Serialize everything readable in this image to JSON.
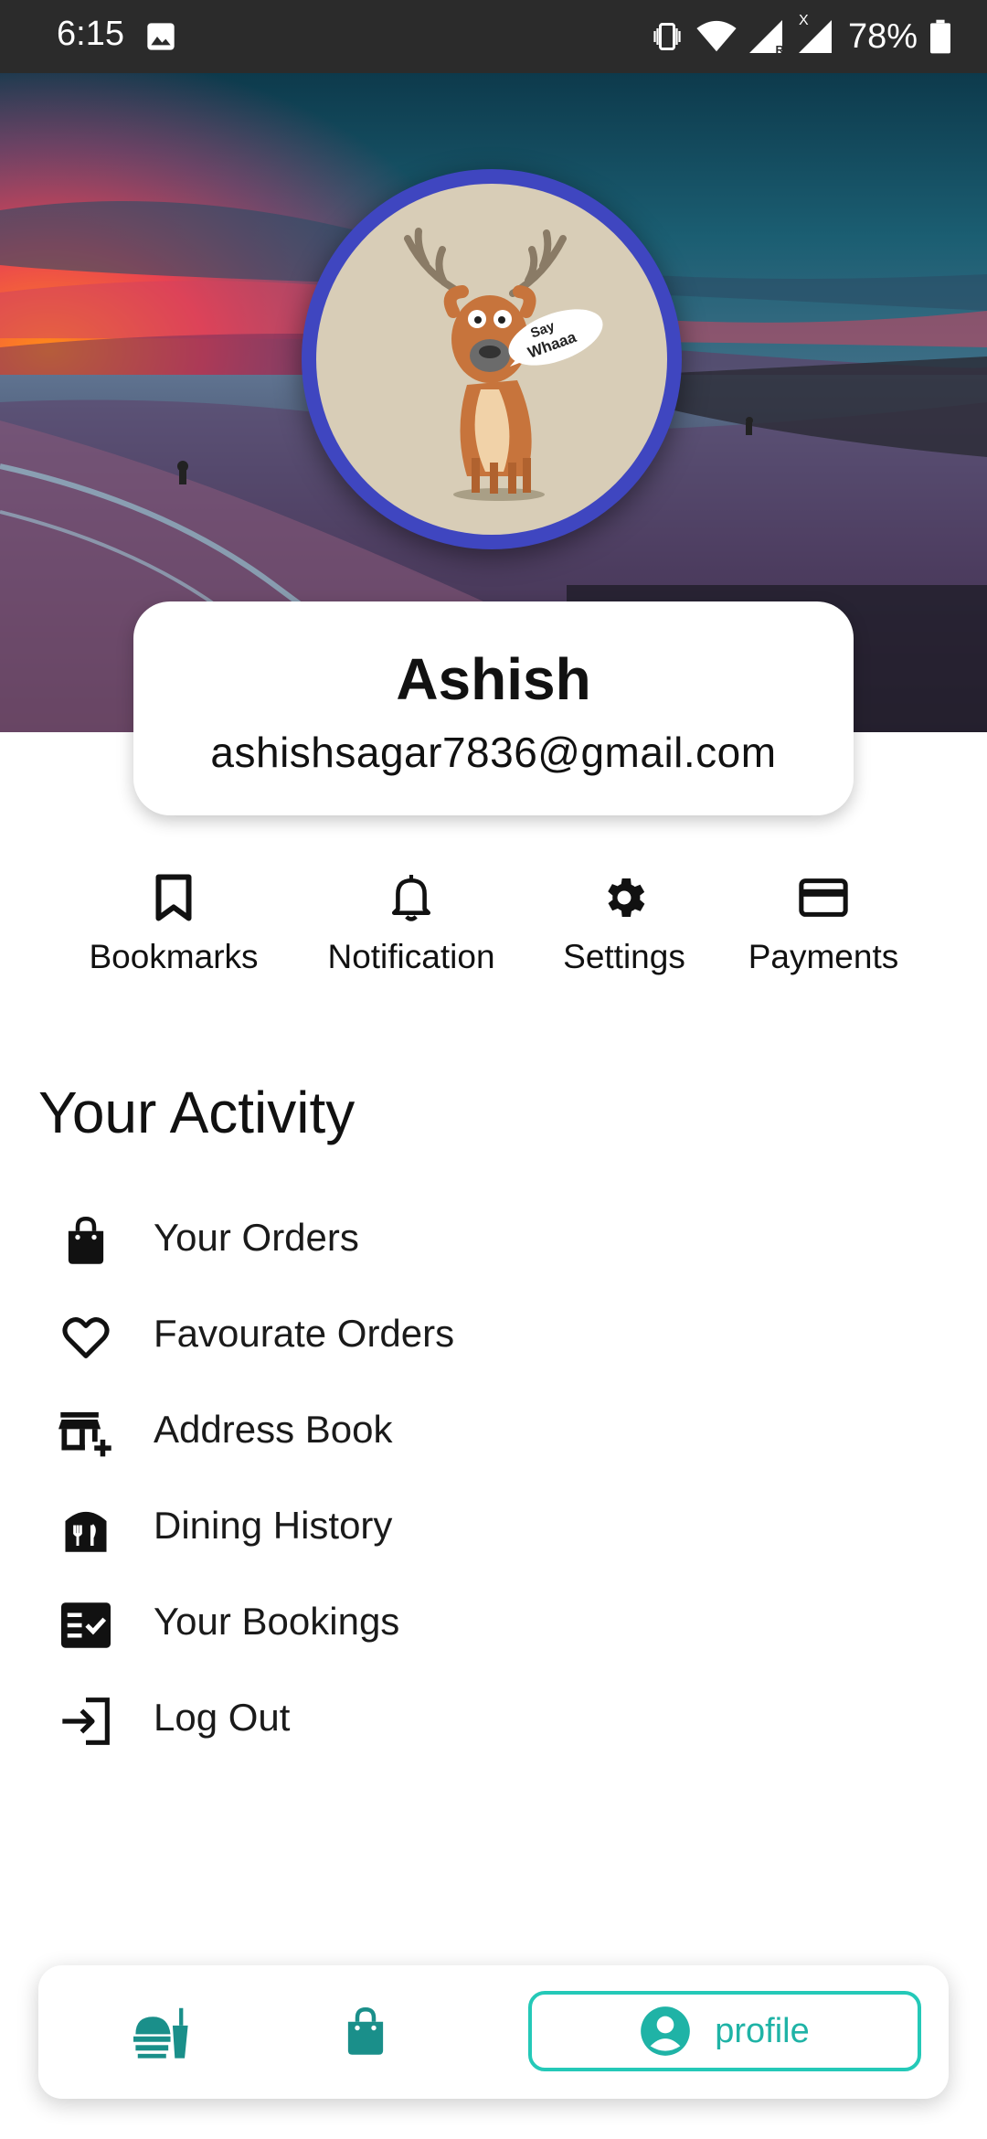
{
  "status_bar": {
    "time": "6:15",
    "battery": "78%",
    "network_badge": "R",
    "signal_badge": "X"
  },
  "profile": {
    "name": "Ashish",
    "email": "ashishsagar7836@gmail.com",
    "avatar_speech": [
      "Say",
      "Whaaa"
    ]
  },
  "quick_actions": [
    {
      "label": "Bookmarks",
      "icon": "bookmark-icon"
    },
    {
      "label": "Notification",
      "icon": "bell-icon"
    },
    {
      "label": "Settings",
      "icon": "gear-icon"
    },
    {
      "label": "Payments",
      "icon": "credit-card-icon"
    }
  ],
  "activity": {
    "title": "Your Activity",
    "items": [
      {
        "label": "Your Orders",
        "icon": "shopping-bag-icon"
      },
      {
        "label": "Favourate Orders",
        "icon": "heart-icon"
      },
      {
        "label": "Address Book",
        "icon": "store-add-icon"
      },
      {
        "label": "Dining History",
        "icon": "dining-icon"
      },
      {
        "label": "Your Bookings",
        "icon": "checklist-icon"
      },
      {
        "label": "Log Out",
        "icon": "logout-icon"
      }
    ]
  },
  "bottom_nav": {
    "items": [
      {
        "icon": "food-service-icon"
      },
      {
        "icon": "shopping-bag-icon"
      },
      {
        "icon": "account-circle-icon",
        "label": "profile"
      }
    ],
    "active_color": "#24c9b8"
  },
  "colors": {
    "avatar_ring": "#3f46c0",
    "accent": "#1a8f8a"
  }
}
